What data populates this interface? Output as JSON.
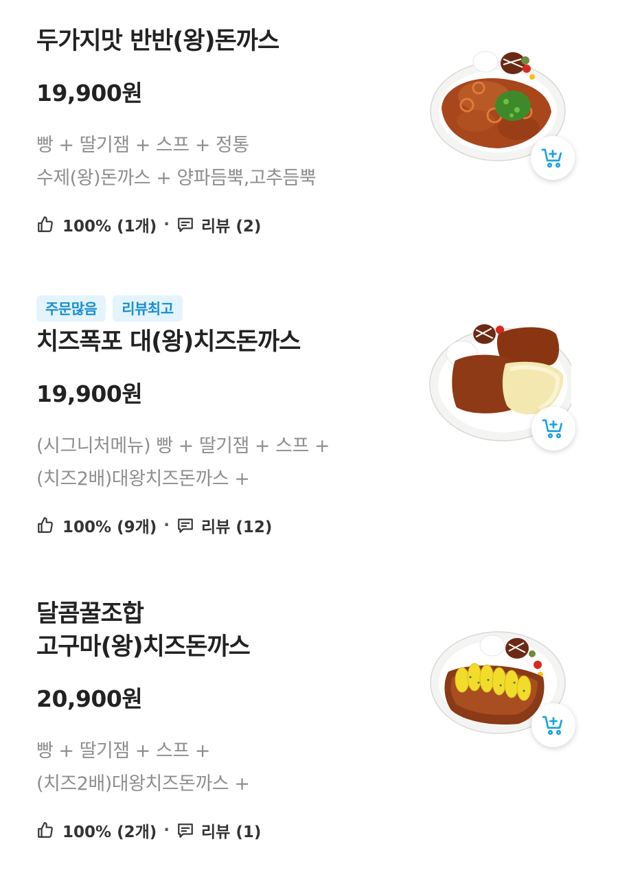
{
  "menu": [
    {
      "badges": [],
      "title_lines": [
        "두가지맛 반반(왕)돈까스"
      ],
      "price": "19,900원",
      "desc_lines": [
        "빵 + 딸기잼 + 스프 + 정통",
        "수제(왕)돈까스 + 양파듬뿍,고추듬뿍"
      ],
      "like_text": "100% (1개)",
      "review_text": "리뷰 (2)"
    },
    {
      "badges": [
        "주문많음",
        "리뷰최고"
      ],
      "title_lines": [
        "치즈폭포 대(왕)치즈돈까스"
      ],
      "price": "19,900원",
      "desc_lines": [
        "(시그니처메뉴) 빵 + 딸기잼 + 스프 +",
        "(치즈2배)대왕치즈돈까스 +"
      ],
      "like_text": "100% (9개)",
      "review_text": "리뷰 (12)"
    },
    {
      "badges": [],
      "title_lines": [
        "달콤꿀조합",
        "고구마(왕)치즈돈까스"
      ],
      "price": "20,900원",
      "desc_lines": [
        "빵 + 딸기잼 + 스프 +",
        "(치즈2배)대왕치즈돈까스 +"
      ],
      "like_text": "100% (2개)",
      "review_text": "리뷰 (1)"
    }
  ],
  "icons": {
    "like": "thumbs-up-icon",
    "review": "comment-icon",
    "cart": "cart-add-icon"
  },
  "colors": {
    "badge_bg": "#e3f4fd",
    "badge_text": "#1b8fd1",
    "cart_icon": "#1aa3e0",
    "desc_text": "#8e8e8e"
  }
}
